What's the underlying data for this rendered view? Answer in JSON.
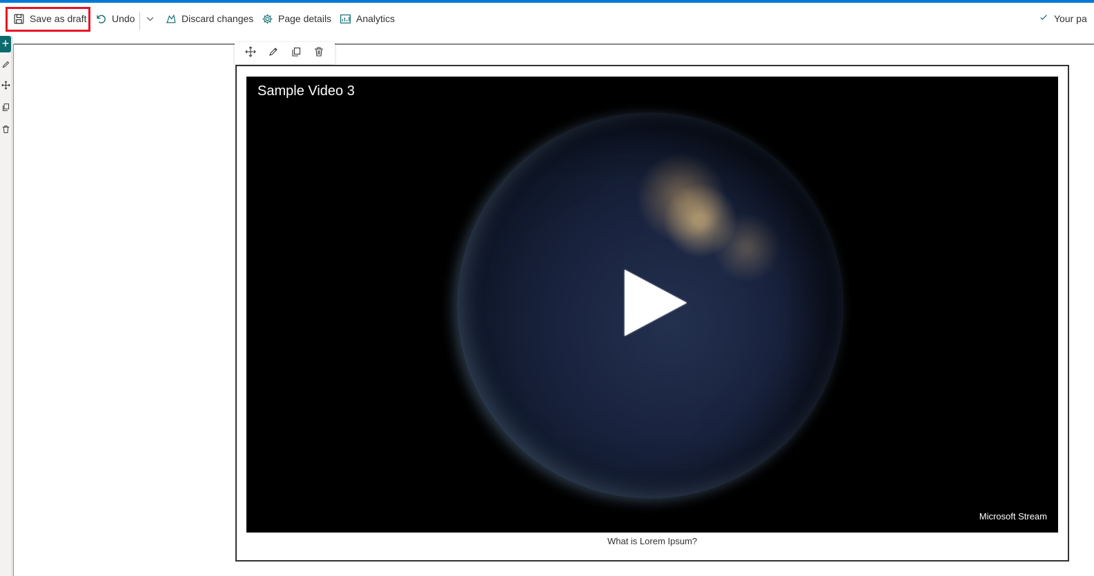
{
  "toolbar": {
    "save_label": "Save as draft",
    "undo_label": "Undo",
    "discard_label": "Discard changes",
    "page_details_label": "Page details",
    "analytics_label": "Analytics",
    "status_text": "Your pa"
  },
  "colors": {
    "accent_bar": "#0078d4",
    "highlight": "#e81123",
    "add_button": "#0b6a6e"
  },
  "rail": {
    "add_symbol": "+",
    "icons": [
      "edit-icon",
      "move-icon",
      "duplicate-icon",
      "delete-icon"
    ]
  },
  "webpart_toolbar": {
    "icons": [
      "move-icon",
      "edit-icon",
      "duplicate-icon",
      "delete-icon"
    ]
  },
  "video": {
    "title": "Sample Video 3",
    "provider": "Microsoft Stream",
    "caption": "What is Lorem Ipsum?"
  }
}
